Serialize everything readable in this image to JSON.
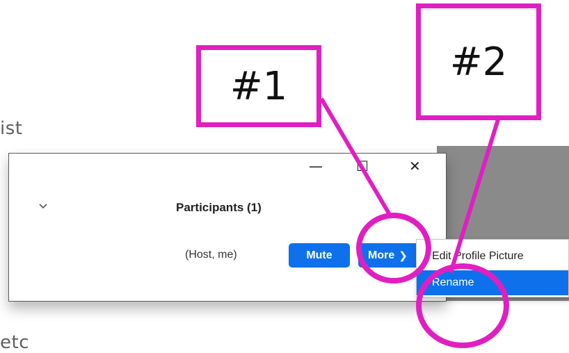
{
  "background": {
    "text_top": "ist",
    "text_bottom": "etc"
  },
  "window": {
    "controls": {
      "minimize_icon": "minimize-icon",
      "maximize_icon": "maximize-icon",
      "close_icon": "close-icon"
    },
    "title": "Participants (1)",
    "participant": {
      "name_suffix": "(Host, me)",
      "mute_label": "Mute",
      "more_label": "More"
    }
  },
  "context_menu": {
    "items": [
      {
        "label": "Edit Profile Picture",
        "active": false
      },
      {
        "label": "Rename",
        "active": true
      }
    ]
  },
  "callouts": {
    "one": "#1",
    "two": "#2"
  },
  "colors": {
    "accent": "#0e71eb",
    "annotation": "#e01fc2",
    "overlay_panel": "#8a8a8a"
  }
}
